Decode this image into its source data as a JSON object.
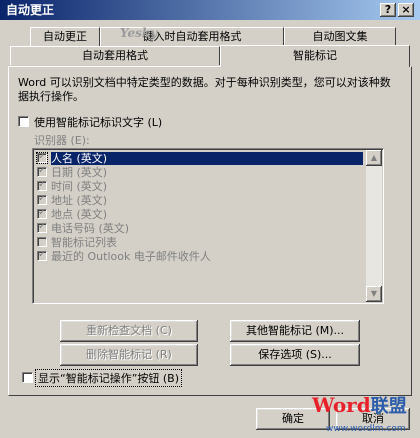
{
  "window": {
    "title": "自动更正",
    "help_btn": "?",
    "close_btn": "×"
  },
  "tabs_row1": [
    "自动更正",
    "键入时自动套用格式",
    "自动图文集"
  ],
  "tabs_row2": [
    "自动套用格式",
    "智能标记"
  ],
  "watermark_top": "Yesky",
  "description": "Word 可以识别文档中特定类型的数据。对于每种识别类型，您可以对该种数据执行操作。",
  "use_tags_label": "使用智能标记标识文字 (L)",
  "recognizers_label": "识别器 (E):",
  "recognizers": [
    {
      "label": "人名 (英文)",
      "checked": true,
      "selected": true
    },
    {
      "label": "日期 (英文)",
      "checked": true
    },
    {
      "label": "时间 (英文)",
      "checked": true
    },
    {
      "label": "地址 (英文)",
      "checked": true
    },
    {
      "label": "地点 (英文)",
      "checked": true
    },
    {
      "label": "电话号码 (英文)",
      "checked": true
    },
    {
      "label": "智能标记列表",
      "checked": false
    },
    {
      "label": "最近的 Outlook 电子邮件收件人",
      "checked": true
    }
  ],
  "buttons": {
    "recheck": "重新检查文档 (C)",
    "more_tags": "其他智能标记 (M)...",
    "remove_tags": "删除智能标记 (R)",
    "save_options": "保存选项 (S)...",
    "ok": "确定",
    "cancel": "取消"
  },
  "show_actions_label": "显示“智能标记操作”按钮 (B)",
  "brand_watermark": {
    "logo_a": "Word",
    "logo_b": "联盟",
    "url": "www.wordlm.com"
  },
  "colors": {
    "title_start": "#0a246a",
    "title_end": "#a6caf0",
    "face": "#d4d0c8",
    "selection": "#0a246a",
    "disabled_text": "#808080",
    "watermark_red": "#e8202a",
    "watermark_blue": "#2a5caa"
  }
}
